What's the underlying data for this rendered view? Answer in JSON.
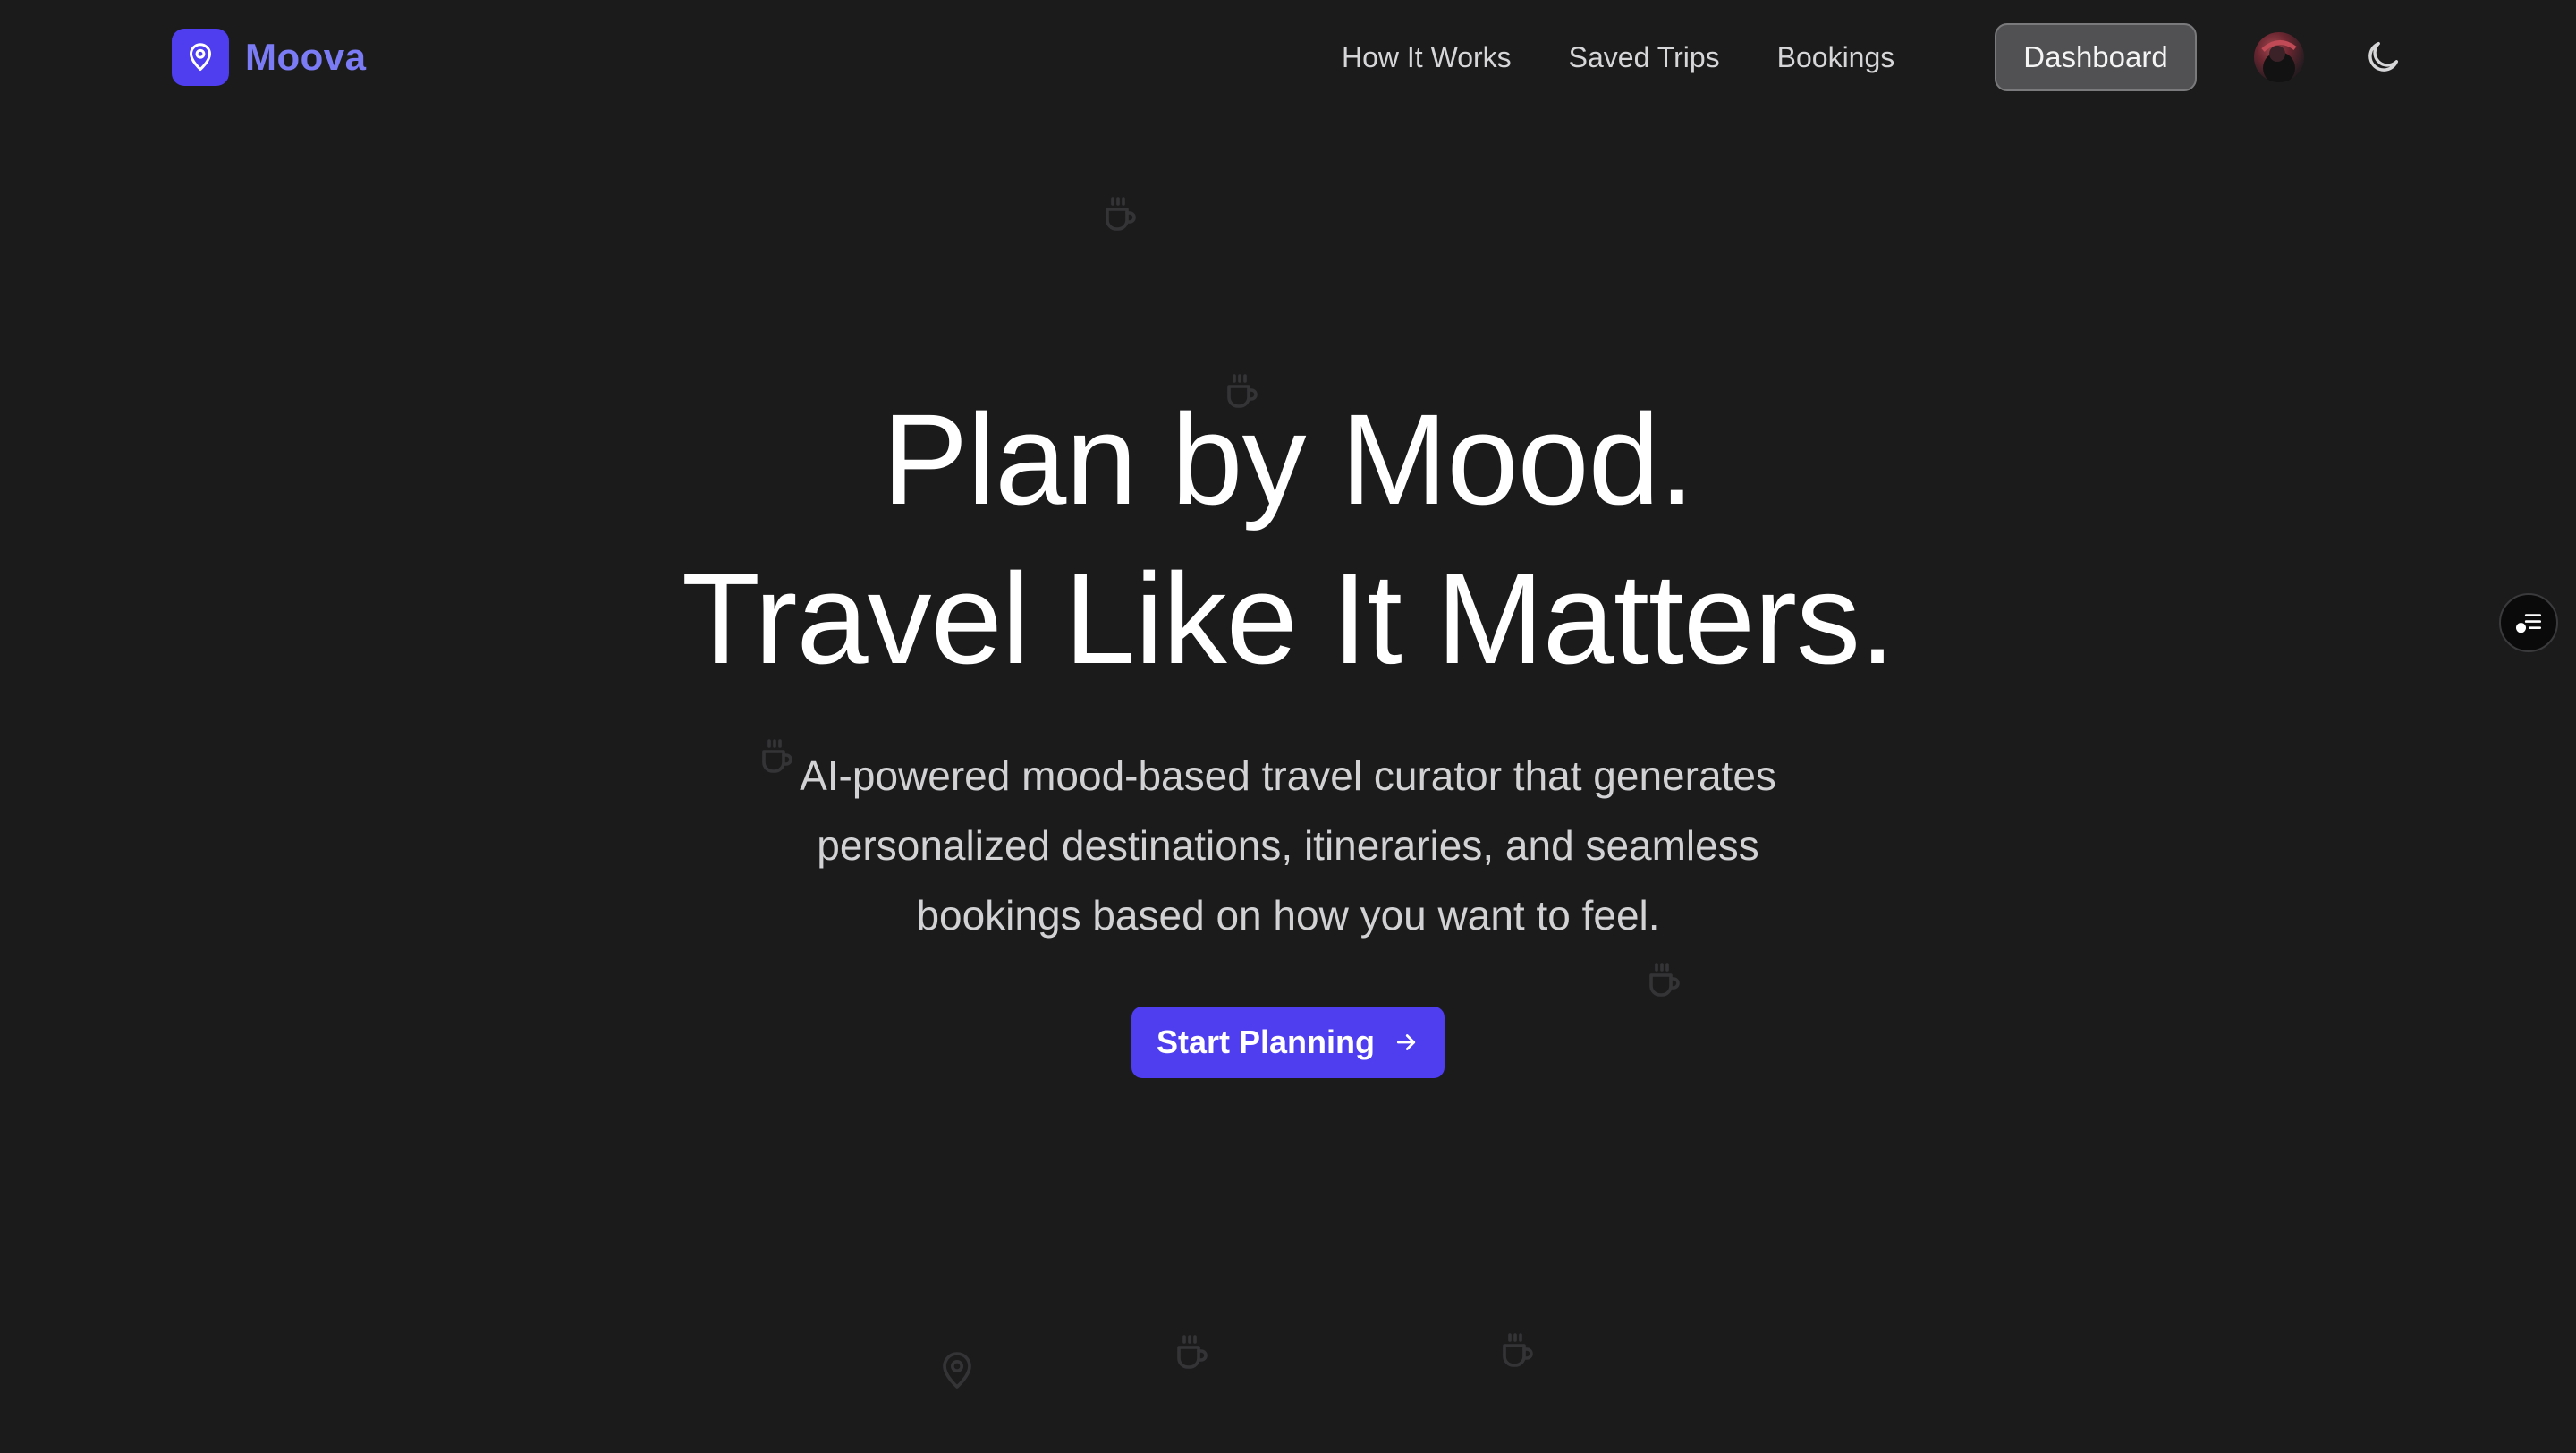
{
  "brand": {
    "name": "Moova",
    "accent_color": "#4f3df0",
    "name_color": "#7b7cf5",
    "icon": "map-pin-icon"
  },
  "nav": {
    "links": [
      "How It Works",
      "Saved Trips",
      "Bookings"
    ],
    "dashboard_label": "Dashboard",
    "theme_icon": "moon-icon"
  },
  "hero": {
    "title_line1": "Plan by Mood.",
    "title_line2": "Travel Like It Matters.",
    "subtitle": "AI-powered mood-based travel curator that generates personalized destinations, itineraries, and seamless bookings based on how you want to feel.",
    "cta_label": "Start Planning",
    "cta_icon": "arrow-right-icon"
  },
  "decor": {
    "icons": [
      "coffee-icon",
      "map-pin-icon"
    ]
  },
  "side_widget": {
    "icon": "list-settings-icon"
  },
  "colors": {
    "background": "#1b1b1c",
    "text": "#ffffff",
    "muted_text": "#d2d2d4"
  }
}
